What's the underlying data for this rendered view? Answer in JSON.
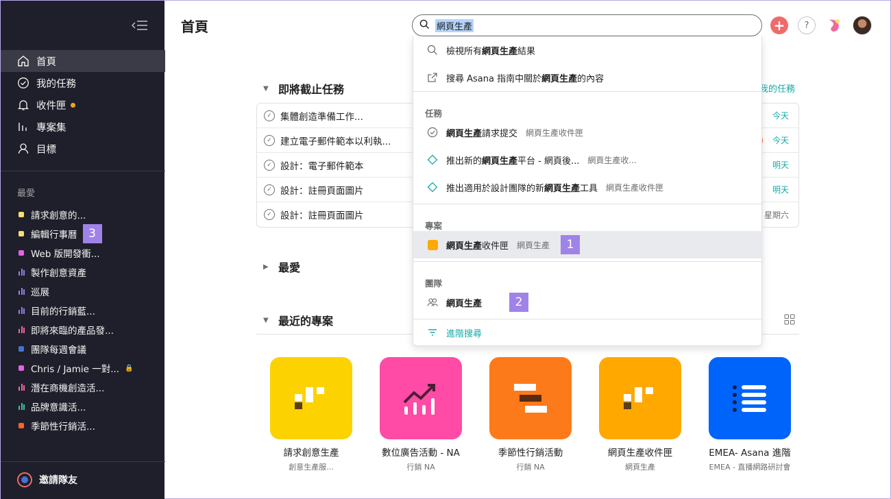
{
  "sidebar": {
    "nav": [
      {
        "label": "首頁",
        "icon": "home-icon"
      },
      {
        "label": "我的任務",
        "icon": "check-circle-icon"
      },
      {
        "label": "收件匣",
        "icon": "bell-icon"
      },
      {
        "label": "專案集",
        "icon": "portfolio-icon"
      },
      {
        "label": "目標",
        "icon": "goal-icon"
      }
    ],
    "favorites_title": "最愛",
    "favorites": [
      {
        "label": "請求創意的...",
        "color": "#f8df72",
        "kind": "square"
      },
      {
        "label": "編輯行事曆",
        "color": "#f8df72",
        "kind": "square"
      },
      {
        "label": "Web 版開發衝...",
        "color": "#e362e3",
        "kind": "square"
      },
      {
        "label": "製作創意資產",
        "color": "#8d84e8",
        "kind": "bars"
      },
      {
        "label": "巡展",
        "color": "#8d84e8",
        "kind": "bars"
      },
      {
        "label": "目前的行銷藍...",
        "color": "#8d84e8",
        "kind": "bars"
      },
      {
        "label": "即將來臨的產品發...",
        "color": "#f06a99",
        "kind": "bars"
      },
      {
        "label": "團隊每週會議",
        "color": "#4573d2",
        "kind": "square"
      },
      {
        "label": "Chris / Jamie 一對...",
        "color": "#e362e3",
        "kind": "square"
      },
      {
        "label": "潛在商機創造活...",
        "color": "#f06a99",
        "kind": "bars"
      },
      {
        "label": "品牌意識活...",
        "color": "#37c5ab",
        "kind": "bars"
      },
      {
        "label": "季節性行銷活...",
        "color": "#fd612c",
        "kind": "square"
      }
    ],
    "badge3": "3",
    "invite": "邀請隊友"
  },
  "header": {
    "title": "首頁",
    "search_value": "網頁生產",
    "plus": "+",
    "help": "?"
  },
  "tasks": {
    "title": "即將截止任務",
    "link": "我的任務",
    "rows": [
      {
        "name": "集體創造準備工作...",
        "due": "今天"
      },
      {
        "name": "建立電子郵件範本以利執...",
        "due": "今天"
      },
      {
        "name": "設計：電子郵件範本",
        "due": "明天"
      },
      {
        "name": "設計：註冊頁面圖片",
        "due": "明天"
      },
      {
        "name": "設計：註冊頁面圖片",
        "due": "星期六"
      }
    ]
  },
  "favorites_section": "最愛",
  "recent": {
    "title": "最近的專案",
    "projects": [
      {
        "name": "請求創意生產",
        "sub": "創意生產服...",
        "color": "#fcd200",
        "icon": "board-icon"
      },
      {
        "name": "數位廣告活動 - NA",
        "sub": "行銷 NA",
        "color": "#ff4ba6",
        "icon": "chart-up-icon"
      },
      {
        "name": "季節性行銷活動",
        "sub": "行銷 NA",
        "color": "#fd7a1a",
        "icon": "timeline-icon"
      },
      {
        "name": "網頁生產收件匣",
        "sub": "網頁生產",
        "color": "#ffa800",
        "icon": "board-icon"
      },
      {
        "name": "EMEA- Asana 進階",
        "sub": "EMEA - 直播網路研討會",
        "color": "#0064fb",
        "icon": "list-icon"
      }
    ]
  },
  "dropdown": {
    "view_all": {
      "pre": "檢視所有",
      "bold": "網頁生產",
      "post": "結果"
    },
    "asana_guide": {
      "pre": "搜尋 Asana 指南中關於",
      "bold": "網頁生產",
      "post": "的內容"
    },
    "tasks_title": "任務",
    "task_results": [
      {
        "pre": "",
        "bold": "網頁生產",
        "post": "請求提交",
        "meta": "網頁生產收件匣",
        "icon": "check-circle-icon"
      },
      {
        "pre": "推出新的",
        "bold": "網頁生產",
        "post": "平台 - 網頁後...",
        "meta": "網頁生產收...",
        "icon": "diamond-icon"
      },
      {
        "pre": "推出適用於設計團隊的新",
        "bold": "網頁生產",
        "post": "工具",
        "meta": "網頁生產收件匣",
        "icon": "diamond-icon"
      }
    ],
    "projects_title": "專案",
    "project_result": {
      "bold": "網頁生產",
      "post": "收件匣",
      "meta": "網頁生產",
      "badge": "1",
      "color": "#ffa800"
    },
    "teams_title": "團隊",
    "team_result": {
      "bold": "網頁生產",
      "badge": "2"
    },
    "advanced": "進階搜尋"
  }
}
